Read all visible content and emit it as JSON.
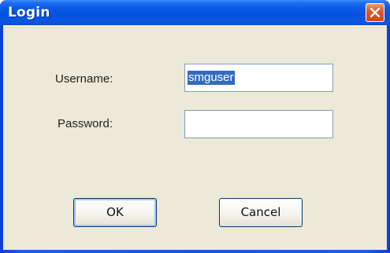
{
  "window": {
    "title": "Login"
  },
  "titlebar": {
    "close_icon": "close-icon"
  },
  "form": {
    "username_label": "Username:",
    "username_value": "smguser",
    "password_label": "Password:",
    "password_value": ""
  },
  "buttons": {
    "ok_label": "OK",
    "cancel_label": "Cancel"
  },
  "colors": {
    "titlebar": "#0652dd",
    "client": "#ece9d8",
    "close_button": "#e2562c",
    "selection": "#316ac5"
  }
}
